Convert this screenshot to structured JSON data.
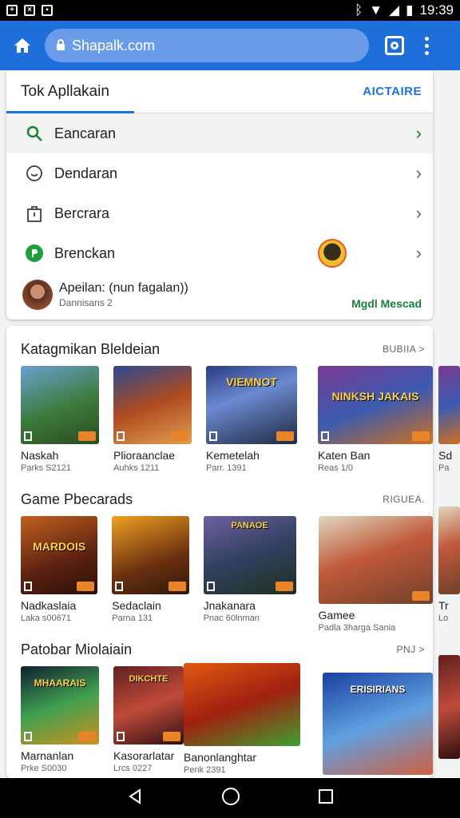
{
  "status": {
    "time": "19:39"
  },
  "browser": {
    "url": "Shapalk.com"
  },
  "top_card": {
    "tab_title": "Tok Apllakain",
    "tab_action": "AICTAIRE",
    "menu": [
      {
        "label": "Eancaran",
        "icon": "search-icon"
      },
      {
        "label": "Dendaran",
        "icon": "smiley-icon"
      },
      {
        "label": "Bercrara",
        "icon": "bag-icon"
      },
      {
        "label": "Brenckan",
        "icon": "play-icon"
      }
    ],
    "account": {
      "name": "Apeilan: (nun fagalan))",
      "sub": "Dannisans 2",
      "link": "Mgdl Mescad"
    }
  },
  "sections": [
    {
      "title": "Katagmikan Bleldeian",
      "more": "BUBIIA >",
      "tiles": [
        {
          "name": "Naskah",
          "sub": "Parks S2121"
        },
        {
          "name": "Plioraanclae",
          "sub": "Auhks 1211"
        },
        {
          "name": "Kemetelah",
          "sub": "Parr. 1391"
        },
        {
          "name": "Katen Ban",
          "sub": "Reas 1/0"
        }
      ],
      "art": [
        "",
        "",
        "VIEMNOT",
        "NINKSH JAKAIS"
      ],
      "side": {
        "name": "Sd",
        "sub": "Pa"
      }
    },
    {
      "title": "Game Pbecarads",
      "more": "RIGUEA.",
      "tiles": [
        {
          "name": "Nadkaslaia",
          "sub": "Laka s00671"
        },
        {
          "name": "Sedaclain",
          "sub": "Parna 131"
        },
        {
          "name": "Jnakanara",
          "sub": "Pnac 60lnman"
        },
        {
          "name": "Gamee",
          "sub": "Padla 3harga Sania"
        }
      ],
      "art": [
        "MARDOIS",
        "",
        "PANAOE",
        ""
      ],
      "side": {
        "name": "Tr",
        "sub": "Lo"
      }
    },
    {
      "title": "Patobar Miolaiain",
      "more": "PNJ >",
      "tiles": [
        {
          "name": "Marnanlan",
          "sub": "Prke S0030"
        },
        {
          "name": "Kasorarlatar",
          "sub": "Lrcs 0227"
        },
        {
          "name": "Banonlanghtar",
          "sub": "Penk 2391"
        },
        {
          "name": "",
          "sub": ""
        }
      ],
      "art": [
        "MHAARAIS",
        "DIKCHTE",
        "",
        "ERISIRIANS"
      ],
      "side": {
        "name": "",
        "sub": ""
      }
    }
  ]
}
